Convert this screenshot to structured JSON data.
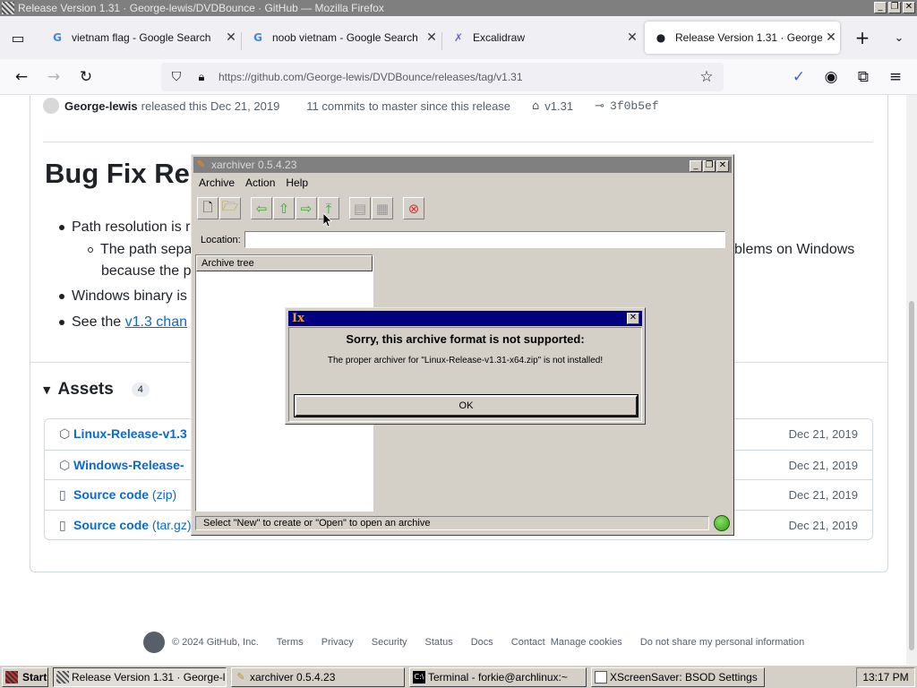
{
  "window": {
    "title": "Release Version 1.31 · George-lewis/DVDBounce · GitHub — Mozilla Firefox",
    "btn_minimize": "_",
    "btn_restore": "❐",
    "btn_close": "✕"
  },
  "tabs": [
    {
      "label": "vietnam flag - Google Search",
      "icon": "google-icon",
      "favicon": "G",
      "close": "✕"
    },
    {
      "label": "noob vietnam - Google Search",
      "icon": "google-icon",
      "favicon": "G",
      "close": "✕"
    },
    {
      "label": "Excalidraw",
      "icon": "excalidraw-icon",
      "favicon": "✗",
      "close": "✕"
    },
    {
      "label": "Release Version 1.31 · George-lewis",
      "icon": "github-icon",
      "favicon": "●",
      "close": "✕",
      "active": true
    }
  ],
  "toolbar": {
    "url": "https://github.com/George-lewis/DVDBounce/releases/tag/v1.31"
  },
  "release": {
    "author": "George-lewis",
    "released_text": "released this Dec 21, 2019",
    "commits_link": "11 commits",
    "commits_suffix": "to master since this release",
    "tag": "v1.31",
    "commit_sha": "3f0b5ef",
    "title": "Bug Fix Re",
    "bullets": [
      {
        "text": "Path resolution is r",
        "level": 1
      },
      {
        "text": "The path sepa",
        "level": 2
      },
      {
        "text": "because the p",
        "level": 0
      },
      {
        "text": "Windows binary is r",
        "level": 1
      },
      {
        "text_prefix": "See the ",
        "link": "v1.3 chan",
        "level": 1
      }
    ],
    "bullet_right_fragment": "blems on Windows"
  },
  "assets": {
    "heading": "Assets",
    "count": "4",
    "items": [
      {
        "name": "Linux-Release-v1.3",
        "suffix": "",
        "date": "Dec 21, 2019",
        "icon": "package-icon"
      },
      {
        "name": "Windows-Release-",
        "suffix": "",
        "date": "Dec 21, 2019",
        "icon": "package-icon"
      },
      {
        "name": "Source code",
        "suffix": "(zip)",
        "date": "Dec 21, 2019",
        "icon": "file-zip-icon"
      },
      {
        "name": "Source code",
        "suffix": "(tar.gz)",
        "date": "Dec 21, 2019",
        "icon": "file-zip-icon"
      }
    ]
  },
  "footer": {
    "copyright": "© 2024 GitHub, Inc.",
    "links": [
      "Terms",
      "Privacy",
      "Security",
      "Status",
      "Docs",
      "Contact",
      "Manage cookies",
      "Do not share my personal information"
    ]
  },
  "xarchiver": {
    "title": "xarchiver 0.5.4.23",
    "menus": [
      "Archive",
      "Action",
      "Help"
    ],
    "location_label": "Location:",
    "location_value": "",
    "tree_header": "Archive tree",
    "status": "Select \"New\" to create or \"Open\" to open an archive"
  },
  "dialog": {
    "heading": "Sorry, this archive format is not supported:",
    "message": "The proper archiver for \"Linux-Release-v1.31-x64.zip\" is not installed!",
    "ok": "OK"
  },
  "taskbar": {
    "start": "Start",
    "items": [
      {
        "label": "Release Version 1.31 · George-le...",
        "active": true
      },
      {
        "label": "xarchiver 0.5.4.23",
        "active": false
      },
      {
        "label": "Terminal - forkie@archlinux:~",
        "active": false
      },
      {
        "label": "XScreenSaver: BSOD Settings",
        "active": false
      }
    ],
    "clock": "13:17 PM"
  }
}
